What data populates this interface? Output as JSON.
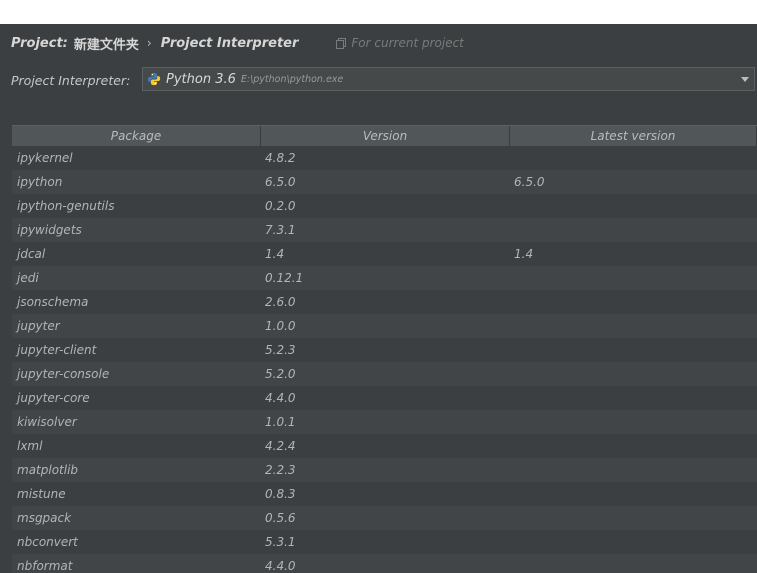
{
  "breadcrumb": {
    "project_label": "Project:",
    "project_name": "新建文件夹",
    "separator": "›",
    "page": "Project Interpreter",
    "scope": "For current project"
  },
  "interpreter": {
    "label": "Project Interpreter:",
    "name": "Python 3.6",
    "path": "E:\\python\\python.exe"
  },
  "table": {
    "headers": [
      "Package",
      "Version",
      "Latest version"
    ],
    "rows": [
      {
        "package": "ipykernel",
        "version": "4.8.2",
        "latest": ""
      },
      {
        "package": "ipython",
        "version": "6.5.0",
        "latest": "6.5.0"
      },
      {
        "package": "ipython-genutils",
        "version": "0.2.0",
        "latest": ""
      },
      {
        "package": "ipywidgets",
        "version": "7.3.1",
        "latest": ""
      },
      {
        "package": "jdcal",
        "version": "1.4",
        "latest": "1.4"
      },
      {
        "package": "jedi",
        "version": "0.12.1",
        "latest": ""
      },
      {
        "package": "jsonschema",
        "version": "2.6.0",
        "latest": ""
      },
      {
        "package": "jupyter",
        "version": "1.0.0",
        "latest": ""
      },
      {
        "package": "jupyter-client",
        "version": "5.2.3",
        "latest": ""
      },
      {
        "package": "jupyter-console",
        "version": "5.2.0",
        "latest": ""
      },
      {
        "package": "jupyter-core",
        "version": "4.4.0",
        "latest": ""
      },
      {
        "package": "kiwisolver",
        "version": "1.0.1",
        "latest": ""
      },
      {
        "package": "lxml",
        "version": "4.2.4",
        "latest": ""
      },
      {
        "package": "matplotlib",
        "version": "2.2.3",
        "latest": ""
      },
      {
        "package": "mistune",
        "version": "0.8.3",
        "latest": ""
      },
      {
        "package": "msgpack",
        "version": "0.5.6",
        "latest": ""
      },
      {
        "package": "nbconvert",
        "version": "5.3.1",
        "latest": ""
      },
      {
        "package": "nbformat",
        "version": "4.4.0",
        "latest": ""
      }
    ]
  },
  "icons": {
    "scope": "copy-icon",
    "interpreter": "python-logo-icon",
    "dropdown": "chevron-down-icon"
  },
  "colors": {
    "panel_bg": "#3c3f41",
    "row_alt_bg": "#414547",
    "header_bg": "#515658",
    "python_blue": "#3f7cb5",
    "python_yellow": "#f5c83a"
  }
}
